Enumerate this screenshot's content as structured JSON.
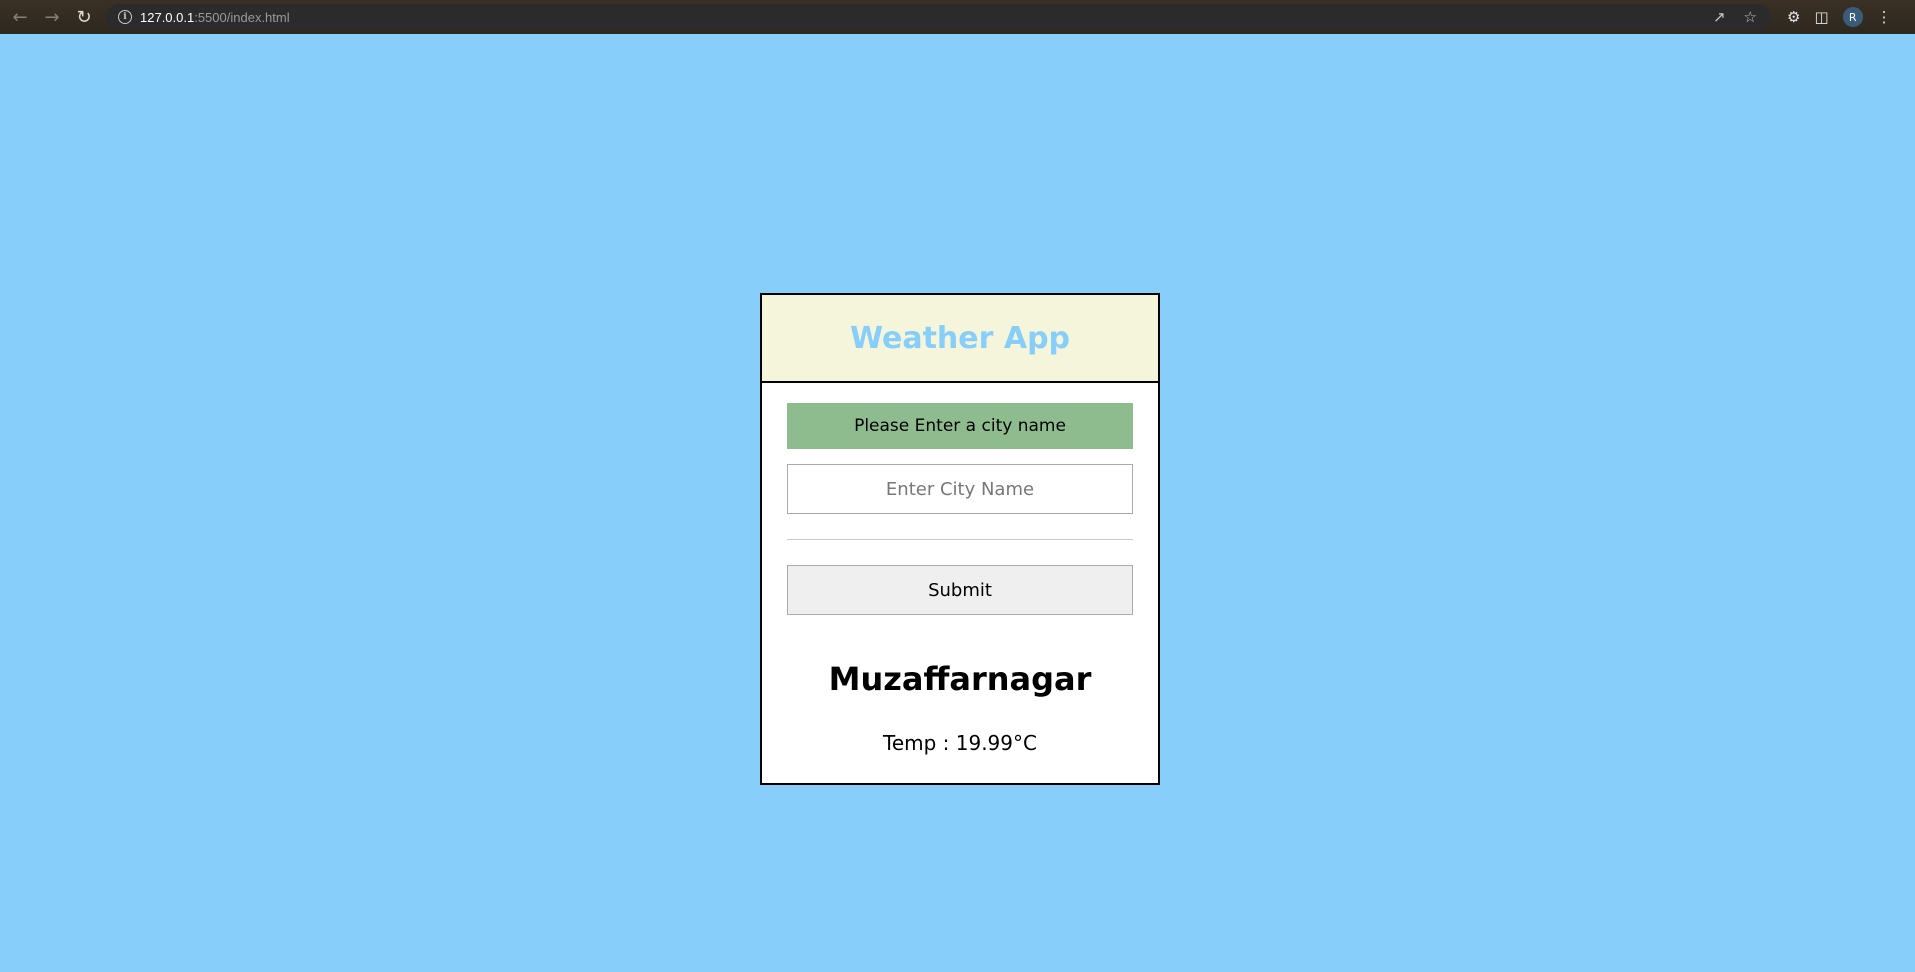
{
  "browser": {
    "url_host": "127.0.0.1",
    "url_path": ":5500/index.html",
    "profile_initial": "R"
  },
  "app": {
    "title": "Weather App",
    "message": "Please Enter a city name",
    "input": {
      "value": "",
      "placeholder": "Enter City Name"
    },
    "submit_label": "Submit",
    "city": "Muzaffarnagar",
    "temp": "Temp : 19.99°C"
  },
  "colors": {
    "background": "#87cefa",
    "header_bg": "#f5f5dc",
    "title": "#87cefa",
    "message_bg": "#8fbc8f"
  },
  "icons": [
    "back-icon",
    "forward-icon",
    "reload-icon",
    "info-icon",
    "share-icon",
    "star-icon",
    "extensions-icon",
    "side-panel-icon",
    "menu-icon"
  ]
}
